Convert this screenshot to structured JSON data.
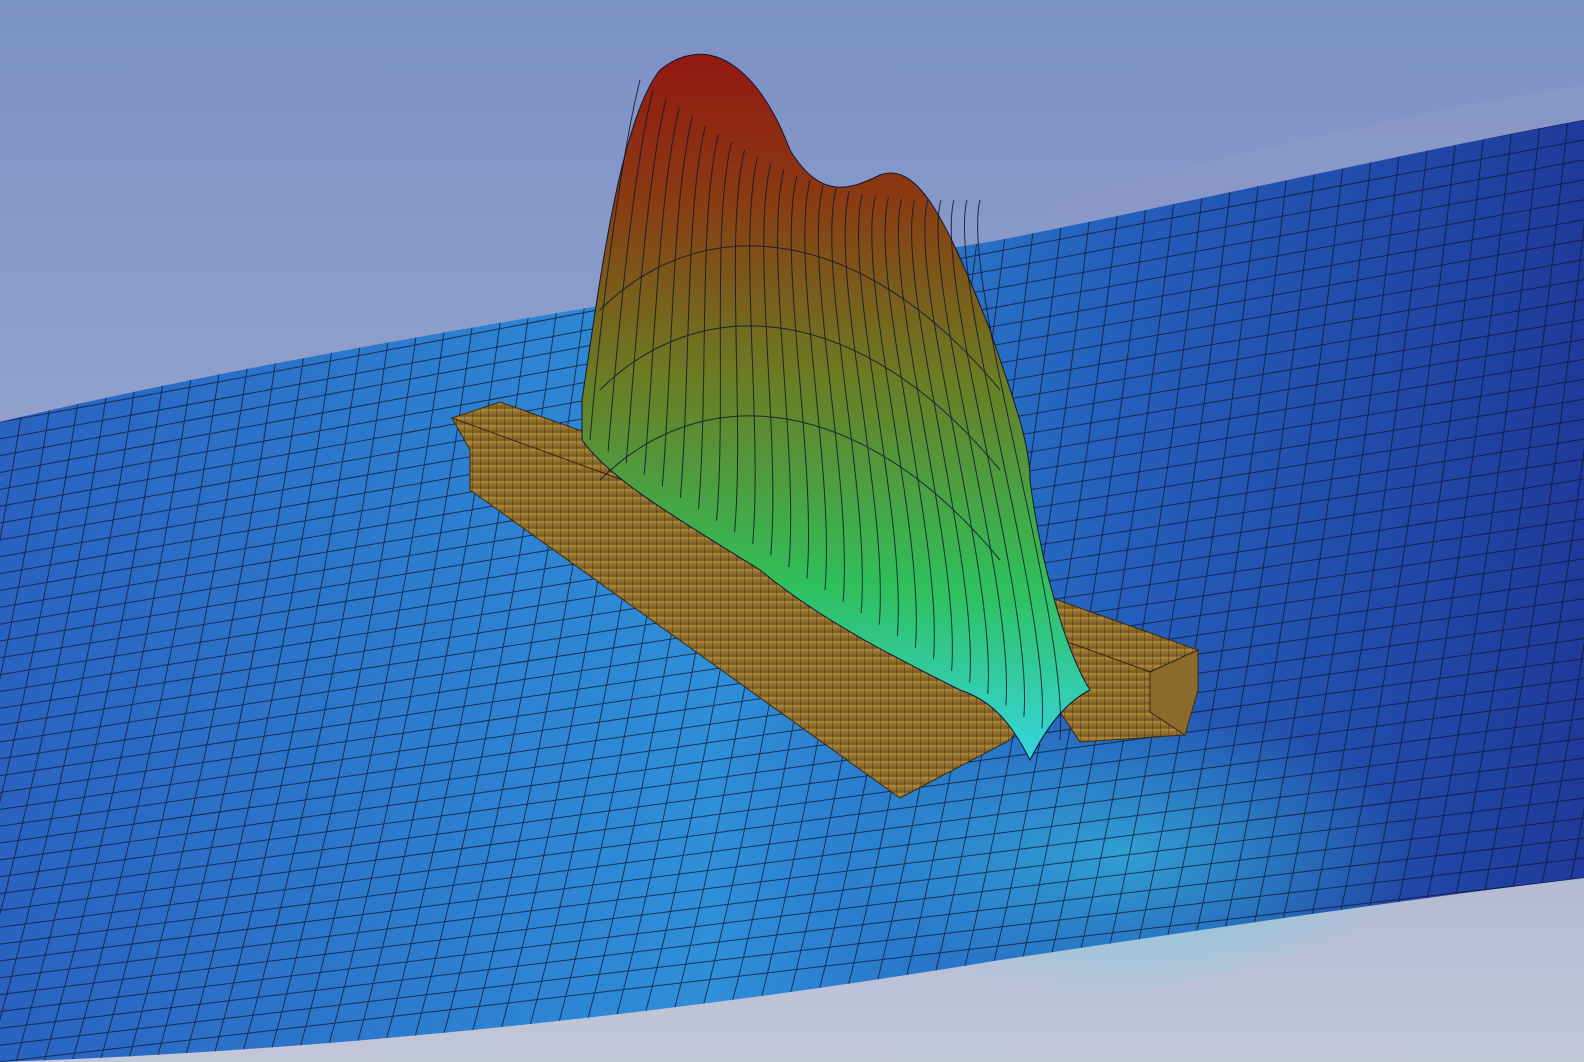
{
  "scene": {
    "background_top": "#7e93c6",
    "background_bottom": "#b8c0d6",
    "surface_far": "#1f3a9a",
    "surface_near": "#2f8fd8",
    "mesh_line": "#0d1630",
    "block_fill": "#a8823a",
    "block_mesh": "#3a2a10",
    "peak_colors": [
      "#36d6e0",
      "#2fbf5a",
      "#6d7a22",
      "#8a3a12",
      "#8f1a12"
    ],
    "icons": [
      "fem-mesh-surface",
      "bearing-block",
      "pressure-peak"
    ]
  }
}
